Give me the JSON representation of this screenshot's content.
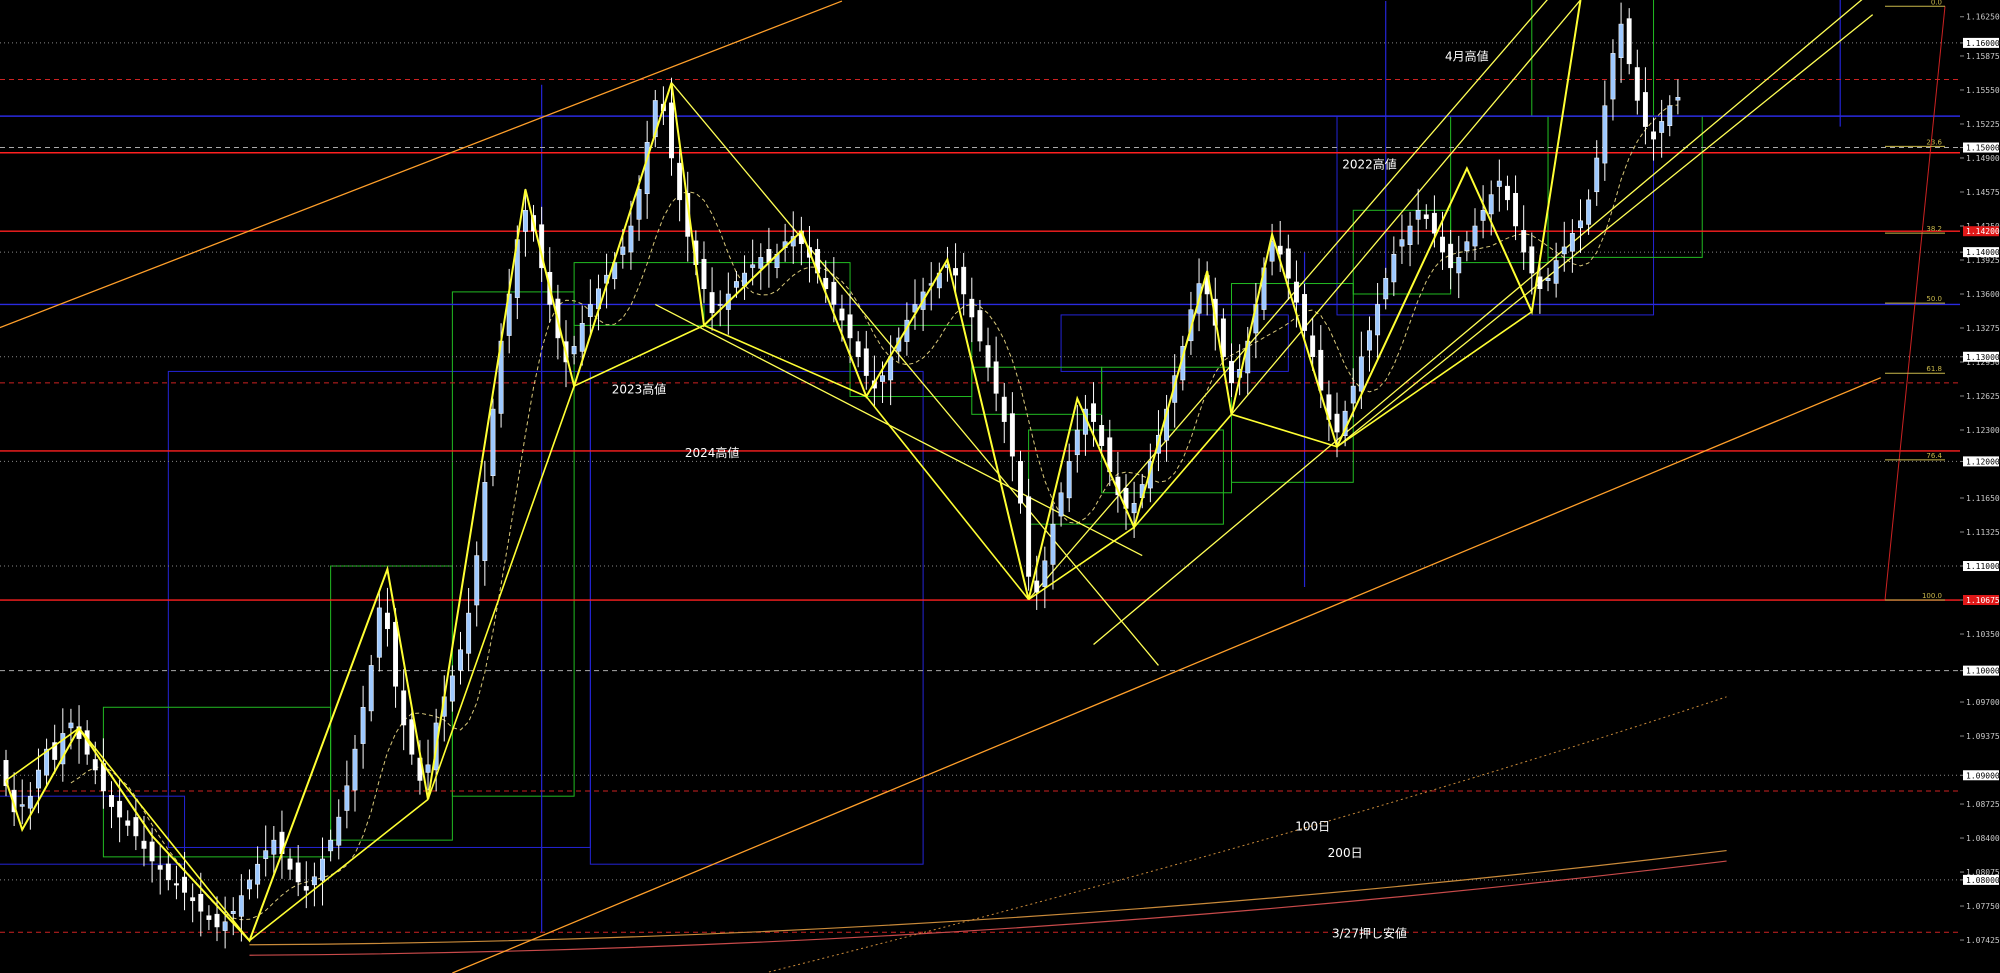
{
  "chart_data": {
    "type": "candlestick",
    "title": "",
    "xlabel": "",
    "ylabel": "",
    "ylim": [
      1.0711,
      1.1641
    ],
    "grid": false,
    "colors": {
      "background": "#000000",
      "candle_up": "#9ec9ff",
      "candle_down": "#ffffff",
      "wick": "#ffffff",
      "zigzag": "#ffff33",
      "channel": "#ffff55",
      "long_trend": "#ff9f2a",
      "support_resistance": "#ff1f1f",
      "box_blue": "#2424d6",
      "box_green": "#22bb22",
      "fib": "#cc2222",
      "axis_text": "#c8c8c8",
      "ma_short": "#d8c87a",
      "ma_100": "#c98a3a",
      "ma_200": "#c84a4a"
    },
    "y_axis_ticks": [
      "1.16250",
      "1.16000",
      "1.15875",
      "1.15550",
      "1.15225",
      "1.15000",
      "1.14900",
      "1.14575",
      "1.14250",
      "1.14000",
      "1.13925",
      "1.13600",
      "1.13275",
      "1.13000",
      "1.12950",
      "1.12625",
      "1.12300",
      "1.12000",
      "1.11650",
      "1.11325",
      "1.11000",
      "1.10675",
      "1.10350",
      "1.10000",
      "1.09700",
      "1.09375",
      "1.09000",
      "1.08725",
      "1.08400",
      "1.08075",
      "1.08000",
      "1.07750",
      "1.07425",
      "1.07100"
    ],
    "price_tags": [
      {
        "price": 1.16,
        "label": "1.16000",
        "style": "plain"
      },
      {
        "price": 1.15,
        "label": "1.15000",
        "style": "plain"
      },
      {
        "price": 1.142,
        "label": "1.14200",
        "style": "red"
      },
      {
        "price": 1.14,
        "label": "1.14000",
        "style": "plain"
      },
      {
        "price": 1.13,
        "label": "1.13000",
        "style": "plain"
      },
      {
        "price": 1.12,
        "label": "1.12000",
        "style": "plain"
      },
      {
        "price": 1.11,
        "label": "1.11000",
        "style": "plain"
      },
      {
        "price": 1.10675,
        "label": "1.10675",
        "style": "red"
      },
      {
        "price": 1.1,
        "label": "1.10000",
        "style": "plain"
      },
      {
        "price": 1.09,
        "label": "1.09000",
        "style": "plain"
      },
      {
        "price": 1.08,
        "label": "1.08000",
        "style": "plain"
      }
    ],
    "horizontal_levels": [
      {
        "price": 1.16,
        "color": "#888888",
        "style": "dotted"
      },
      {
        "price": 1.1565,
        "color": "#cc2222",
        "style": "dashed"
      },
      {
        "price": 1.153,
        "color": "#2a2ae0",
        "style": "solid"
      },
      {
        "price": 1.15,
        "color": "#aaaaaa",
        "style": "dashed"
      },
      {
        "price": 1.1495,
        "color": "#ff2020",
        "style": "solid"
      },
      {
        "price": 1.142,
        "color": "#ff2020",
        "style": "solid"
      },
      {
        "price": 1.14,
        "color": "#888888",
        "style": "dotted"
      },
      {
        "price": 1.135,
        "color": "#2a2ae0",
        "style": "solid"
      },
      {
        "price": 1.13,
        "color": "#888888",
        "style": "dotted"
      },
      {
        "price": 1.1275,
        "color": "#cc2222",
        "style": "dashed"
      },
      {
        "price": 1.121,
        "color": "#ff2020",
        "style": "solid"
      },
      {
        "price": 1.12,
        "color": "#888888",
        "style": "dotted"
      },
      {
        "price": 1.11,
        "color": "#888888",
        "style": "dotted"
      },
      {
        "price": 1.10675,
        "color": "#ff2020",
        "style": "solid"
      },
      {
        "price": 1.1,
        "color": "#aaaaaa",
        "style": "dashed"
      },
      {
        "price": 1.09,
        "color": "#888888",
        "style": "dotted"
      },
      {
        "price": 1.0885,
        "color": "#cc2222",
        "style": "dashed"
      },
      {
        "price": 1.08,
        "color": "#888888",
        "style": "dotted"
      },
      {
        "price": 1.075,
        "color": "#cc2222",
        "style": "dashed"
      }
    ],
    "fibonacci": {
      "high": 1.1635,
      "low": 1.10675,
      "levels": [
        {
          "ratio": 0.0,
          "label": "0.0"
        },
        {
          "ratio": 0.236,
          "label": "23.6"
        },
        {
          "ratio": 0.382,
          "label": "38.2"
        },
        {
          "ratio": 0.5,
          "label": "50.0"
        },
        {
          "ratio": 0.618,
          "label": "61.8"
        },
        {
          "ratio": 0.764,
          "label": "76.4"
        },
        {
          "ratio": 1.0,
          "label": "100.0"
        }
      ]
    },
    "annotations": [
      {
        "text": "4月高値",
        "bar": 180,
        "price": 1.1583
      },
      {
        "text": "2022高値",
        "bar": 168,
        "price": 1.148
      },
      {
        "text": "2023高値",
        "bar": 78,
        "price": 1.1265
      },
      {
        "text": "2024高値",
        "bar": 87,
        "price": 1.1204
      },
      {
        "text": "100日",
        "bar": 161,
        "price": 1.0847
      },
      {
        "text": "200日",
        "bar": 165,
        "price": 1.0822
      },
      {
        "text": "3/27押し安値",
        "bar": 168,
        "price": 1.0745
      }
    ],
    "zigzag_points": [
      {
        "bar": 0,
        "price": 1.0895
      },
      {
        "bar": 2,
        "price": 1.0848
      },
      {
        "bar": 9,
        "price": 1.0945
      },
      {
        "bar": 18,
        "price": 1.0842
      },
      {
        "bar": 30,
        "price": 1.0742
      },
      {
        "bar": 47,
        "price": 1.1097
      },
      {
        "bar": 52,
        "price": 1.0877
      },
      {
        "bar": 64,
        "price": 1.146
      },
      {
        "bar": 70,
        "price": 1.1272
      },
      {
        "bar": 82,
        "price": 1.1562
      },
      {
        "bar": 86,
        "price": 1.133
      },
      {
        "bar": 98,
        "price": 1.142
      },
      {
        "bar": 106,
        "price": 1.1262
      },
      {
        "bar": 116,
        "price": 1.1393
      },
      {
        "bar": 126,
        "price": 1.1068
      },
      {
        "bar": 132,
        "price": 1.126
      },
      {
        "bar": 139,
        "price": 1.1137
      },
      {
        "bar": 148,
        "price": 1.1382
      },
      {
        "bar": 151,
        "price": 1.1245
      },
      {
        "bar": 156,
        "price": 1.1417
      },
      {
        "bar": 164,
        "price": 1.1214
      },
      {
        "bar": 180,
        "price": 1.148
      },
      {
        "bar": 188,
        "price": 1.1343
      },
      {
        "bar": 194,
        "price": 1.1641
      }
    ],
    "trend_lines": [
      {
        "role": "channel",
        "from": {
          "bar": 134,
          "price": 1.1025
        },
        "to": {
          "bar": 230,
          "price": 1.165
        }
      },
      {
        "role": "channel",
        "from": {
          "bar": 126,
          "price": 1.1068
        },
        "to": {
          "bar": 192,
          "price": 1.166
        }
      },
      {
        "role": "channel",
        "from": {
          "bar": 164,
          "price": 1.1214
        },
        "to": {
          "bar": 230,
          "price": 1.1627
        }
      },
      {
        "role": "channel",
        "from": {
          "bar": 151,
          "price": 1.1245
        },
        "to": {
          "bar": 194,
          "price": 1.1641
        }
      },
      {
        "role": "channel",
        "from": {
          "bar": 82,
          "price": 1.1562
        },
        "to": {
          "bar": 142,
          "price": 1.1005
        }
      },
      {
        "role": "channel",
        "from": {
          "bar": 80,
          "price": 1.135
        },
        "to": {
          "bar": 140,
          "price": 1.111
        }
      },
      {
        "role": "long_trend",
        "from": {
          "bar": -10,
          "price": 1.13
        },
        "to": {
          "bar": 103,
          "price": 1.164
        }
      },
      {
        "role": "long_trend",
        "from": {
          "bar": 55,
          "price": 1.0711
        },
        "to": {
          "bar": 231,
          "price": 1.128
        }
      }
    ],
    "ohlc_note": "approximate daily EUR/USD-style candles read from the chart",
    "candles": {
      "closes": [
        1.089,
        1.0865,
        1.0872,
        1.088,
        1.0905,
        1.0925,
        1.0915,
        1.094,
        1.095,
        1.0935,
        1.092,
        1.0905,
        1.0885,
        1.087,
        1.086,
        1.0852,
        1.0842,
        1.083,
        1.0818,
        1.081,
        1.08,
        1.0795,
        1.0788,
        1.078,
        1.077,
        1.0762,
        1.0755,
        1.076,
        1.077,
        1.0785,
        1.08,
        1.0815,
        1.0828,
        1.0838,
        1.0825,
        1.081,
        1.0798,
        1.079,
        1.0803,
        1.082,
        1.0838,
        1.086,
        1.089,
        1.0925,
        1.0965,
        1.1005,
        1.106,
        1.104,
        1.0985,
        1.0948,
        1.092,
        1.0895,
        1.091,
        1.095,
        1.0975,
        1.0995,
        1.102,
        1.1055,
        1.111,
        1.118,
        1.125,
        1.1315,
        1.136,
        1.1412,
        1.144,
        1.142,
        1.1385,
        1.135,
        1.1318,
        1.1295,
        1.131,
        1.1332,
        1.135,
        1.1365,
        1.1378,
        1.139,
        1.1405,
        1.1425,
        1.146,
        1.1505,
        1.1545,
        1.1535,
        1.149,
        1.145,
        1.1415,
        1.1388,
        1.1365,
        1.1342,
        1.135,
        1.136,
        1.1372,
        1.138,
        1.1388,
        1.1395,
        1.139,
        1.1398,
        1.141,
        1.1415,
        1.1408,
        1.1395,
        1.138,
        1.1365,
        1.135,
        1.1335,
        1.1318,
        1.13,
        1.1282,
        1.127,
        1.1282,
        1.13,
        1.1318,
        1.1335,
        1.135,
        1.1362,
        1.137,
        1.138,
        1.1388,
        1.1378,
        1.136,
        1.1338,
        1.1315,
        1.129,
        1.1265,
        1.1238,
        1.1205,
        1.116,
        1.109,
        1.1075,
        1.1105,
        1.114,
        1.117,
        1.12,
        1.123,
        1.125,
        1.1238,
        1.1215,
        1.119,
        1.1168,
        1.1155,
        1.116,
        1.1178,
        1.12,
        1.1225,
        1.125,
        1.1282,
        1.131,
        1.1345,
        1.137,
        1.136,
        1.133,
        1.13,
        1.1275,
        1.1288,
        1.1315,
        1.135,
        1.1385,
        1.141,
        1.1398,
        1.1375,
        1.1352,
        1.1325,
        1.13,
        1.1268,
        1.124,
        1.1228,
        1.1248,
        1.1272,
        1.13,
        1.1325,
        1.135,
        1.1375,
        1.1398,
        1.1412,
        1.1425,
        1.144,
        1.1432,
        1.1418,
        1.14,
        1.1385,
        1.1395,
        1.141,
        1.1425,
        1.144,
        1.1455,
        1.1468,
        1.145,
        1.1425,
        1.14,
        1.138,
        1.1365,
        1.1375,
        1.1392,
        1.1405,
        1.1418,
        1.143,
        1.145,
        1.149,
        1.154,
        1.159,
        1.1618,
        1.158,
        1.1545,
        1.152,
        1.1508,
        1.1525,
        1.154,
        1.1548
      ],
      "opens_offset_pattern": [
        0.0018,
        -0.0012,
        0.0015,
        -0.001,
        0.0022,
        -0.0014
      ]
    },
    "moving_averages": [
      {
        "name": "100日",
        "role": "ma_100",
        "from": {
          "bar": 30,
          "price": 1.0738
        },
        "to": {
          "bar": 212,
          "price": 1.0828
        }
      },
      {
        "name": "200日",
        "role": "ma_200",
        "from": {
          "bar": 30,
          "price": 1.0728
        },
        "to": {
          "bar": 212,
          "price": 1.0818
        }
      }
    ]
  }
}
